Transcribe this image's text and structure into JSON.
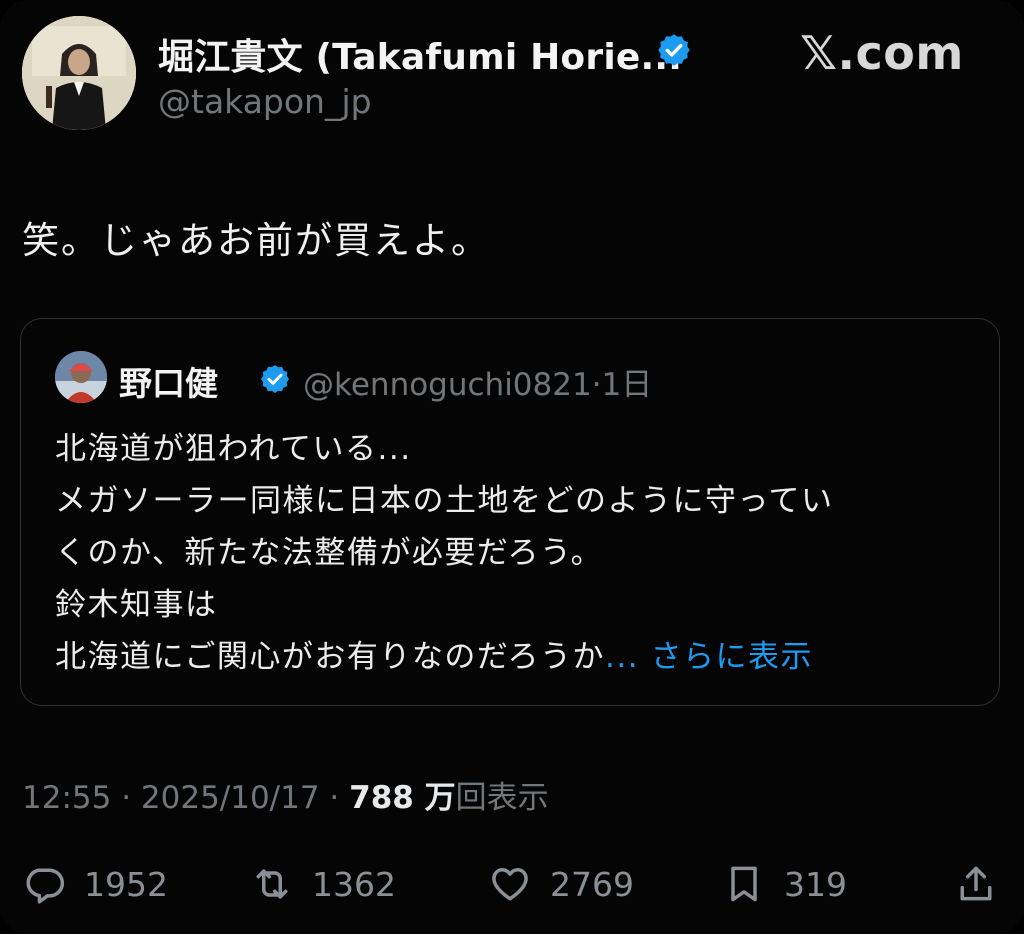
{
  "author": {
    "name": "堀江貴文 (Takafumi Horie...",
    "handle": "@takapon_jp",
    "verified": true
  },
  "brand": {
    "logo_text": "𝕏.com"
  },
  "tweet": {
    "text": "笑。じゃあお前が買えよ。"
  },
  "quote": {
    "name": "野口健",
    "handle_time": "@kennoguchi0821·1日",
    "lines": [
      "北海道が狙われている...",
      "メガソーラー同様に日本の土地をどのように守ってい",
      "くのか、新たな法整備が必要だろう。",
      "鈴木知事は"
    ],
    "last_line": "北海道にご関心がお有りなのだろうか",
    "show_more": "... さらに表示"
  },
  "meta": {
    "time_date": "12:55 · 2025/10/17 · ",
    "views_count": "788 万",
    "views_label": "回表示"
  },
  "actions": {
    "replies": "1952",
    "reposts": "1362",
    "likes": "2769",
    "bookmarks": "319"
  },
  "colors": {
    "accent": "#1d9bf0",
    "muted": "#71767b",
    "background": "#000000"
  },
  "icons": [
    "reply-icon",
    "repost-icon",
    "like-icon",
    "bookmark-icon",
    "share-icon",
    "verified-icon"
  ]
}
